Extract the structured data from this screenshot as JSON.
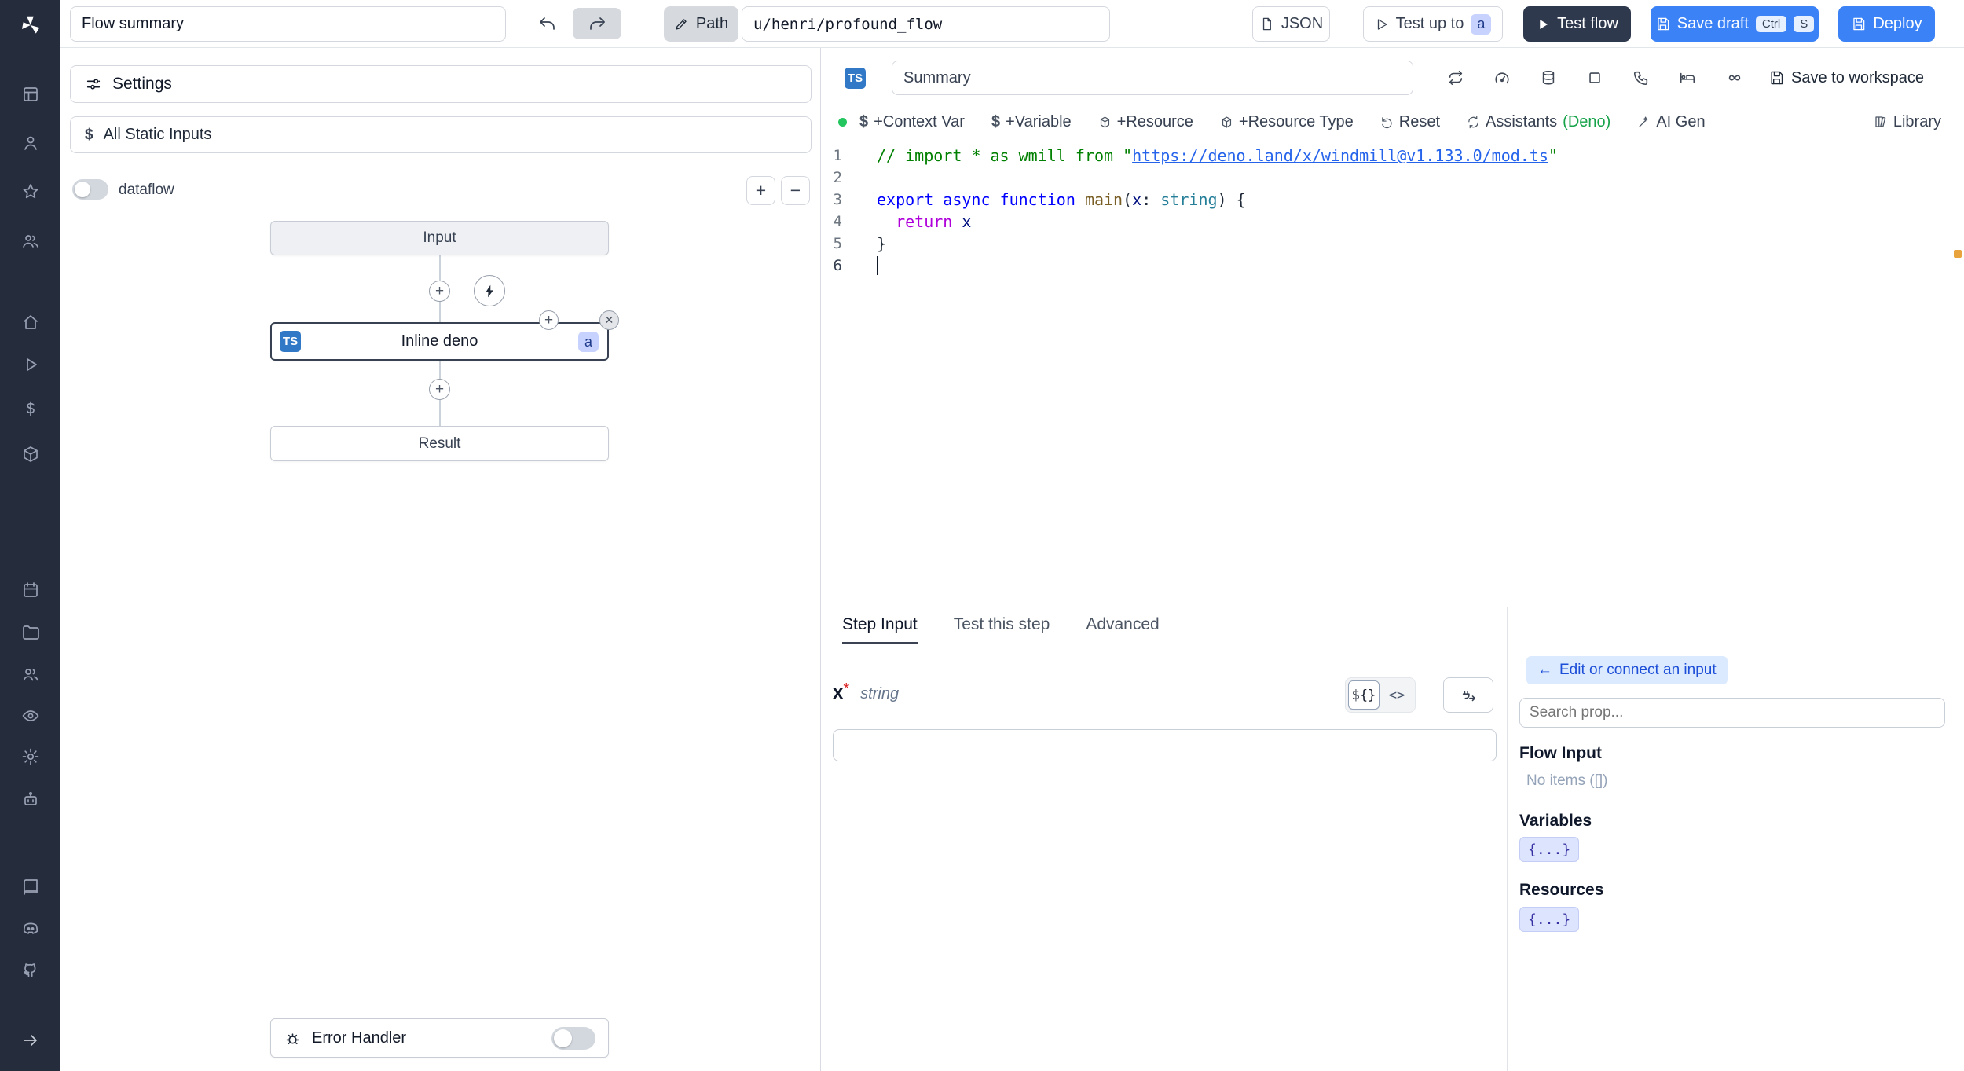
{
  "colors": {
    "sidebar_bg": "#252d3d",
    "primary_blue": "#3b82f6",
    "dark_button": "#2f394d",
    "badge_bg": "#c7d2fe",
    "light_blue_bg": "#dbeafe",
    "green_dot": "#22c55e",
    "deno_green": "#16a34a",
    "required_red": "#dc2626",
    "marker_orange": "#e8a33d",
    "ts_badge_blue": "#3178c6"
  },
  "sidebar": {
    "icons": [
      "windmill-logo",
      "grid",
      "user",
      "star",
      "users",
      "home",
      "play",
      "dollar",
      "cube",
      "calendar",
      "folder",
      "group",
      "eye",
      "gear",
      "robot",
      "book",
      "discord",
      "github",
      "expand-arrow"
    ]
  },
  "topbar": {
    "flow_summary_value": "Flow summary",
    "path_label": "Path",
    "path_value": "u/henri/profound_flow",
    "json_label": "JSON",
    "test_up_to_label": "Test up to",
    "test_up_to_badge": "a",
    "test_flow_label": "Test flow",
    "save_draft_label": "Save draft",
    "kbd": [
      "Ctrl",
      "S"
    ],
    "deploy_label": "Deploy"
  },
  "flow": {
    "settings_label": "Settings",
    "all_static_inputs_label": "All Static Inputs",
    "dataflow_label": "dataflow",
    "zoom_in": "+",
    "zoom_out": "−",
    "input_node": "Input",
    "step_node": "Inline deno",
    "step_lang_badge": "TS",
    "step_suffix_badge": "a",
    "result_node": "Result",
    "error_handler_label": "Error Handler"
  },
  "editor": {
    "lang_badge": "TS",
    "summary_value": "Summary",
    "save_to_workspace_label": "Save to workspace",
    "library_label": "Library",
    "toolbar": [
      {
        "label": "+Context Var"
      },
      {
        "label": "+Variable"
      },
      {
        "label": "+Resource"
      },
      {
        "label": "+Resource Type"
      },
      {
        "label": "Reset"
      },
      {
        "label": "Assistants",
        "suffix": "(Deno)"
      },
      {
        "label": "AI Gen"
      }
    ],
    "cursor_line": 6,
    "syntax_colors": {
      "comment": "#008000",
      "link": "#2563eb",
      "keyword": "#0000ff",
      "control": "#af00db",
      "func": "#795e26",
      "param": "#001080",
      "type": "#267f99",
      "plain": "#1f2937"
    },
    "code_lines": [
      [
        {
          "t": "// import * as wmill from \"",
          "c": "comment"
        },
        {
          "t": "https://deno.land/x/windmill@v1.133.0/mod.ts",
          "c": "link",
          "u": true
        },
        {
          "t": "\"",
          "c": "comment"
        }
      ],
      [],
      [
        {
          "t": "export",
          "c": "keyword"
        },
        {
          "t": " ",
          "c": "plain"
        },
        {
          "t": "async",
          "c": "keyword"
        },
        {
          "t": " ",
          "c": "plain"
        },
        {
          "t": "function",
          "c": "keyword"
        },
        {
          "t": " ",
          "c": "plain"
        },
        {
          "t": "main",
          "c": "func"
        },
        {
          "t": "(",
          "c": "plain"
        },
        {
          "t": "x",
          "c": "param"
        },
        {
          "t": ": ",
          "c": "plain"
        },
        {
          "t": "string",
          "c": "type"
        },
        {
          "t": ") {",
          "c": "plain"
        }
      ],
      [
        {
          "t": "  ",
          "c": "plain"
        },
        {
          "t": "return",
          "c": "control"
        },
        {
          "t": " ",
          "c": "plain"
        },
        {
          "t": "x",
          "c": "param"
        }
      ],
      [
        {
          "t": "}",
          "c": "plain"
        }
      ],
      []
    ]
  },
  "step_panel": {
    "tabs": [
      "Step Input",
      "Test this step",
      "Advanced"
    ],
    "arg_name": "x",
    "arg_required_mark": "*",
    "arg_type": "string",
    "expr_toggle": [
      "${}",
      "<>"
    ],
    "prop_picker": {
      "back_arrow": "←",
      "edit_connect_label": "Edit or connect an input",
      "search_placeholder": "Search prop...",
      "flow_input_heading": "Flow Input",
      "flow_input_empty": "No items ([])",
      "variables_heading": "Variables",
      "resources_heading": "Resources",
      "object_token": "{...}"
    }
  }
}
